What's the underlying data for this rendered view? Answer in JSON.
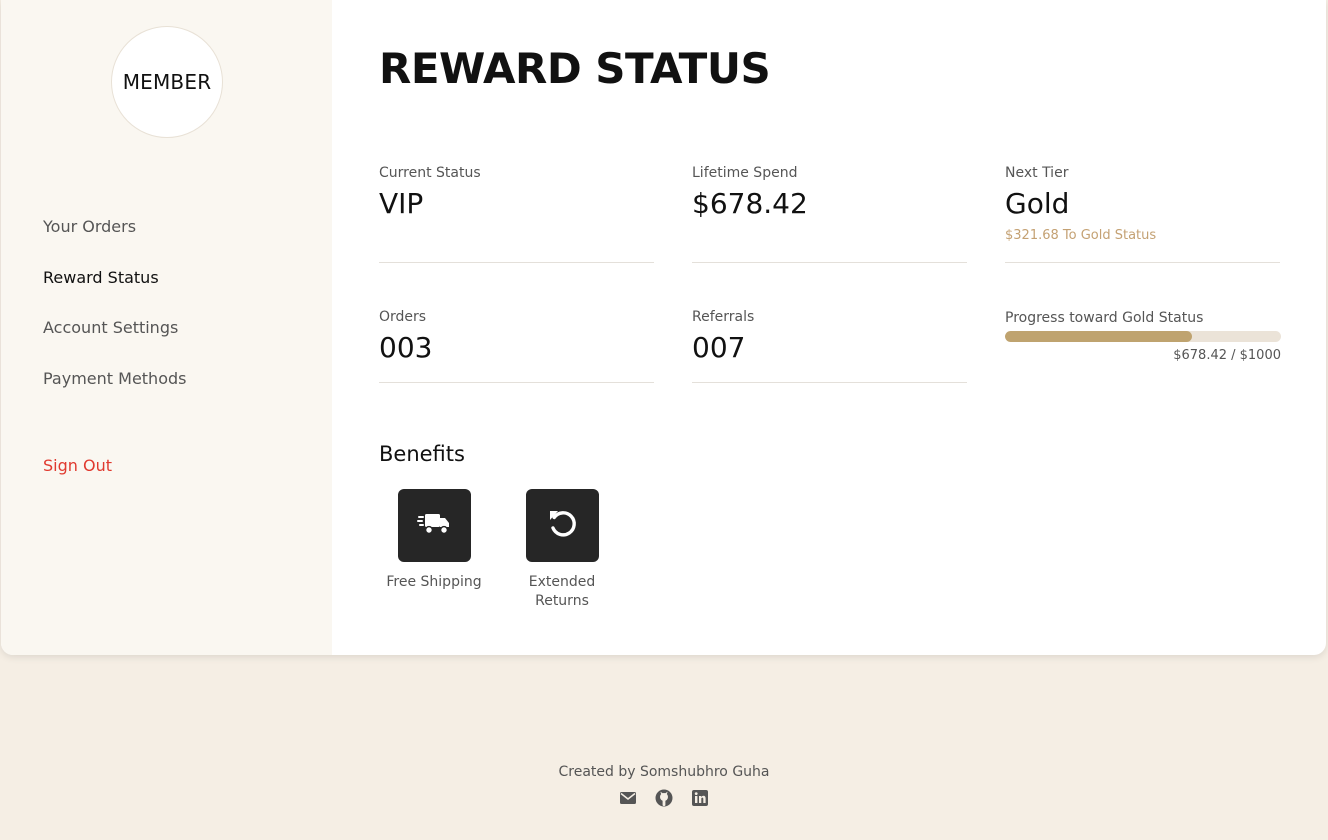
{
  "sidebar": {
    "avatar_text": "MEMBER",
    "nav": [
      "Your Orders",
      "Reward Status",
      "Account Settings",
      "Payment Methods"
    ],
    "active_item": "Reward Status",
    "sign_out": "Sign Out"
  },
  "main": {
    "title": "REWARD STATUS",
    "stats": {
      "current_status": {
        "label": "Current Status",
        "value": "VIP"
      },
      "lifetime_spend": {
        "label": "Lifetime Spend",
        "value": "$678.42"
      },
      "next_tier": {
        "label": "Next Tier",
        "value": "Gold",
        "sub": "$321.68 To Gold Status"
      },
      "orders": {
        "label": "Orders",
        "value": "003"
      },
      "referrals": {
        "label": "Referrals",
        "value": "007"
      }
    },
    "progress": {
      "label": "Progress toward Gold Status",
      "readout": "$678.42 / $1000",
      "fraction": 0.678
    },
    "benefits": {
      "title": "Benefits",
      "items": [
        {
          "label": "Free Shipping",
          "icon": "shipping-truck-icon"
        },
        {
          "label": "Extended Returns",
          "icon": "return-arrow-icon"
        }
      ]
    }
  },
  "footer": {
    "credit": "Created by Somshubhro Guha",
    "icons": [
      "email-icon",
      "github-icon",
      "linkedin-icon"
    ]
  },
  "colors": {
    "page_bg": "#f5eee4",
    "sidebar_bg": "#faf7f1",
    "accent": "#bfa36f",
    "accent_text": "#c4a173",
    "danger": "#e03a2f",
    "benefit_tile": "#262626"
  }
}
